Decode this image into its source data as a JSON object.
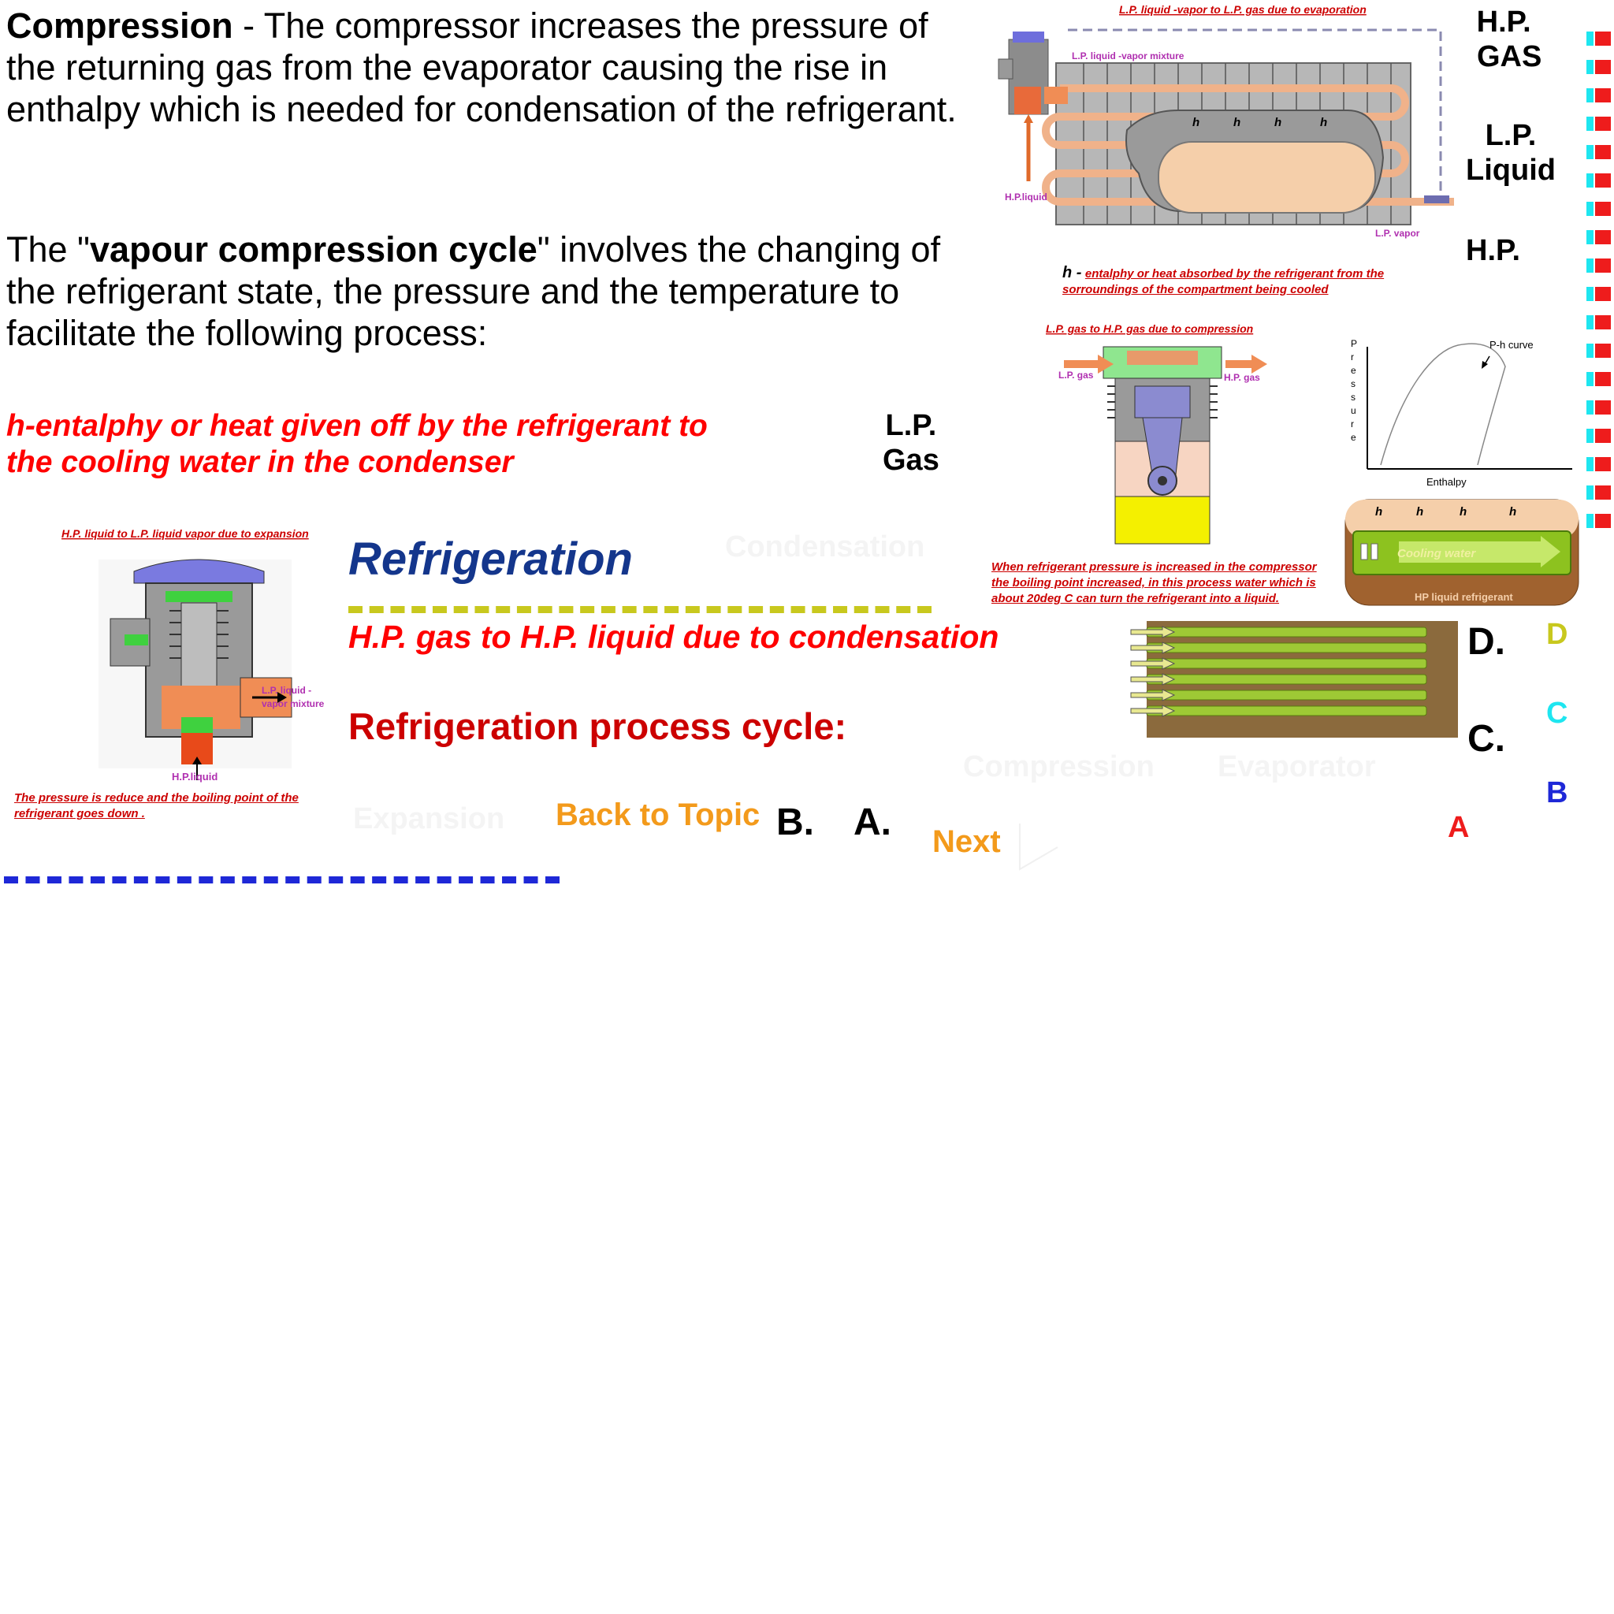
{
  "compression": {
    "term": "Compression",
    "text": " - The compressor increases the pressure of the returning gas from the evaporator causing the rise in enthalpy which is needed for condensation of the refrigerant."
  },
  "cycle": {
    "before": "The \"",
    "term": "vapour compression cycle",
    "after": "\" involves the changing of the refrigerant state, the pressure and the temperature to facilitate the following process:"
  },
  "h_condenser_line1": "h-entalphy or heat given off by the refrigerant to",
  "h_condenser_line2": "the cooling water in the condenser",
  "labels": {
    "lp_gas_line1": "L.P.",
    "lp_gas_line2": "Gas",
    "hp_gas_line1": "H.P.",
    "hp_gas_line2": "GAS",
    "lp_liquid_line1": "L.P.",
    "lp_liquid_line2": "Liquid",
    "hp": "H.P."
  },
  "evaporator": {
    "caption": "L.P. liquid -vapor to L.P. gas due to evaporation",
    "mixture": "L.P. liquid -vapor mixture",
    "hp_liquid": "H.P.liquid",
    "lp_vapor": "L.P. vapor",
    "h": "h",
    "enthalpy_h": "h -",
    "enthalpy_note_line1": "entalphy or heat absorbed by the refrigerant from the",
    "enthalpy_note_line2": "sorroundings of the  compartment being cooled"
  },
  "compressor": {
    "caption": "L.P. gas to H.P. gas due to compression",
    "lp_gas": "L.P. gas",
    "hp_gas": "H.P. gas",
    "note_line1": "When refrigerant pressure is increased  in the compressor",
    "note_line2": "the boiling point increased, in this process water which is",
    "note_line3": "about 20deg C can turn the refrigerant into a liquid."
  },
  "ph_chart": {
    "curve_label": "P-h curve",
    "ylabel_letters": [
      "P",
      "r",
      "e",
      "s",
      "s",
      "u",
      "r",
      "e"
    ],
    "xlabel": "Enthalpy"
  },
  "condenser": {
    "h": "h",
    "cooling_water": "Cooling water",
    "hp_liquid": "HP liquid refrigerant"
  },
  "expansion": {
    "caption": "H.P. liquid to L.P. liquid vapor due to expansion",
    "mixture_line1": "L.P. liquid -",
    "mixture_line2": "vapor mixture",
    "hp_liquid": "H.P.liquid",
    "note_line1": "The pressure is reduce and the boiling point  of the",
    "note_line2": "refrigerant goes down ."
  },
  "title": "Refrigeration",
  "hidden": {
    "condensation": "Condensation",
    "compression": "Compression",
    "evaporator": "Evaporator",
    "expansion": "Expansion"
  },
  "condensation_process": "H.P. gas to H.P. liquid due to condensation",
  "process_cycle": "Refrigeration process cycle:",
  "nav": {
    "back": "Back to Topic",
    "next": "Next"
  },
  "letters": {
    "b": "B.",
    "a": "A.",
    "d": "D.",
    "c": "C."
  },
  "legend": [
    {
      "letter": "D",
      "color": "#c8c81e"
    },
    {
      "letter": "C",
      "color": "#1ee6f0"
    },
    {
      "letter": "B",
      "color": "#1e28d7"
    },
    {
      "letter": "A",
      "color": "#ee1c1c"
    }
  ],
  "colors": {
    "red": "#ff0000",
    "dark_red": "#cc0000",
    "navy": "#14368c",
    "olive": "#c8c81e",
    "blue": "#1e28d7",
    "orange": "#f39a1b"
  }
}
